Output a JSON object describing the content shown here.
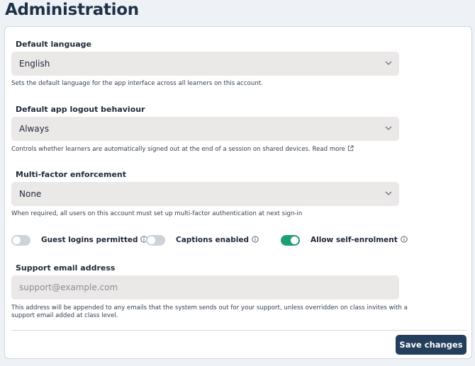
{
  "page": {
    "title": "Administration"
  },
  "default_language": {
    "label": "Default language",
    "value": "English",
    "help": "Sets the default language for the app interface across all learners on this account."
  },
  "logout": {
    "label": "Default app logout behaviour",
    "value": "Always",
    "help": "Controls whether learners are automatically signed out at the end of a session on shared devices. Read more"
  },
  "mfa": {
    "label": "Multi-factor enforcement",
    "value": "None",
    "help": "When required, all users on this account must set up multi-factor authentication at next sign-in"
  },
  "toggles": {
    "guest": {
      "label": "Guest logins permitted",
      "on": false
    },
    "captions": {
      "label": "Captions enabled",
      "on": false
    },
    "self_enrol": {
      "label": "Allow self-enrolment",
      "on": true
    }
  },
  "support_email": {
    "label": "Support email address",
    "value": "",
    "placeholder": "support@example.com",
    "help_line1": "This address will be appended to any emails that the system sends out for your support, unless overridden on class invites with a",
    "help_line2": "support email added at class level."
  },
  "actions": {
    "save_label": "Save changes"
  },
  "colors": {
    "accent": "#243e5c",
    "toggle_on": "#1f9e6e",
    "field_bg": "#ebe8e8"
  }
}
